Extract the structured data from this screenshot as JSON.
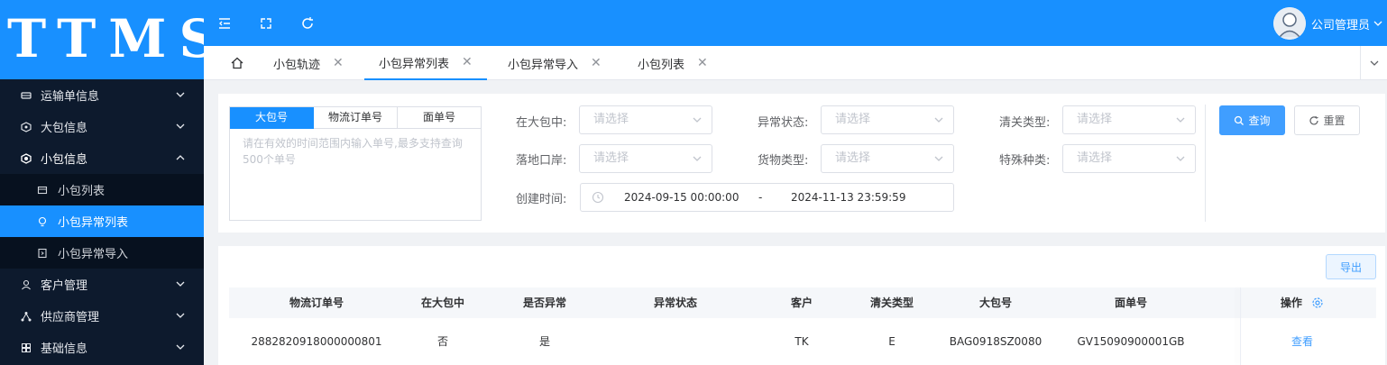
{
  "app": {
    "logo": "TTMS"
  },
  "sidebar": {
    "items": [
      {
        "label": "运输单信息",
        "icon": "truck-icon",
        "expanded": false
      },
      {
        "label": "大包信息",
        "icon": "box-icon",
        "expanded": false
      },
      {
        "label": "小包信息",
        "icon": "package-icon",
        "expanded": true,
        "children": [
          {
            "label": "小包列表",
            "icon": "list-icon",
            "active": false
          },
          {
            "label": "小包异常列表",
            "icon": "bulb-icon",
            "active": true
          },
          {
            "label": "小包异常导入",
            "icon": "import-icon",
            "active": false
          }
        ]
      },
      {
        "label": "客户管理",
        "icon": "user-icon",
        "expanded": false
      },
      {
        "label": "供应商管理",
        "icon": "network-icon",
        "expanded": false
      },
      {
        "label": "基础信息",
        "icon": "grid-icon",
        "expanded": false
      }
    ]
  },
  "header": {
    "icons": [
      "menu-fold-icon",
      "fullscreen-icon",
      "refresh-icon"
    ],
    "user_name": "公司管理员"
  },
  "tabs": [
    {
      "label": "小包轨迹",
      "active": false
    },
    {
      "label": "小包异常列表",
      "active": true
    },
    {
      "label": "小包异常导入",
      "active": false
    },
    {
      "label": "小包列表",
      "active": false
    }
  ],
  "filters": {
    "seg_tabs": [
      "大包号",
      "物流订单号",
      "面单号"
    ],
    "seg_placeholder": "请在有效的时间范围内输入单号,最多支持查询500个单号",
    "in_bag_label": "在大包中:",
    "landing_port_label": "落地口岸:",
    "created_time_label": "创建时间:",
    "exception_status_label": "异常状态:",
    "goods_type_label": "货物类型:",
    "customs_type_label": "清关类型:",
    "special_type_label": "特殊种类:",
    "select_placeholder": "请选择",
    "date_start": "2024-09-15 00:00:00",
    "date_sep": "-",
    "date_end": "2024-11-13 23:59:59",
    "search_label": "查询",
    "reset_label": "重置"
  },
  "table": {
    "export_label": "导出",
    "columns": [
      "物流订单号",
      "在大包中",
      "是否异常",
      "异常状态",
      "客户",
      "清关类型",
      "大包号",
      "面单号",
      "操作"
    ],
    "rows": [
      {
        "order_no": "2882820918000000801",
        "in_bag": "否",
        "is_exception": "是",
        "status": "",
        "customer": "TK",
        "customs_type": "E",
        "bag_no": "BAG0918SZ0080",
        "waybill_no": "GV15090900001GB",
        "action": "查看"
      }
    ]
  },
  "colors": {
    "primary": "#1890ff",
    "sidebar_bg": "#0d1a2d",
    "link": "#409eff"
  }
}
